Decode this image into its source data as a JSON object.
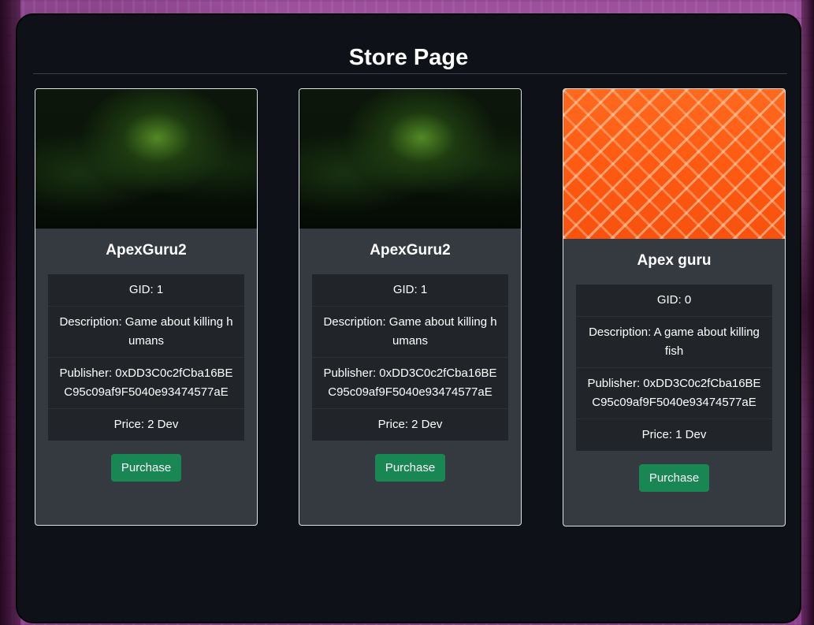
{
  "page": {
    "title": "Store Page"
  },
  "games": [
    {
      "name": "ApexGuru2",
      "gid": "GID: 1",
      "description": "Description: Game about killing humans",
      "publisher": "Publisher: 0xDD3C0c2fCba16BEC95c09af9F5040e93474577aE",
      "price": "Price: 2 Dev",
      "purchase_label": "Purchase",
      "image": "cannabis-plant-image"
    },
    {
      "name": "ApexGuru2",
      "gid": "GID: 1",
      "description": "Description: Game about killing humans",
      "publisher": "Publisher: 0xDD3C0c2fCba16BEC95c09af9F5040e93474577aE",
      "price": "Price: 2 Dev",
      "purchase_label": "Purchase",
      "image": "cannabis-plant-image"
    },
    {
      "name": "Apex guru",
      "gid": "GID: 0",
      "description": "Description: A game about killing fish",
      "publisher": "Publisher: 0xDD3C0c2fCba16BEC95c09af9F5040e93474577aE",
      "price": "Price: 1 Dev",
      "purchase_label": "Purchase",
      "image": "salmon-fillet-image"
    }
  ],
  "colors": {
    "panel_bg": "#0e1117",
    "card_bg": "#343a40",
    "list_bg": "#212529",
    "purchase_button": "#198754"
  }
}
